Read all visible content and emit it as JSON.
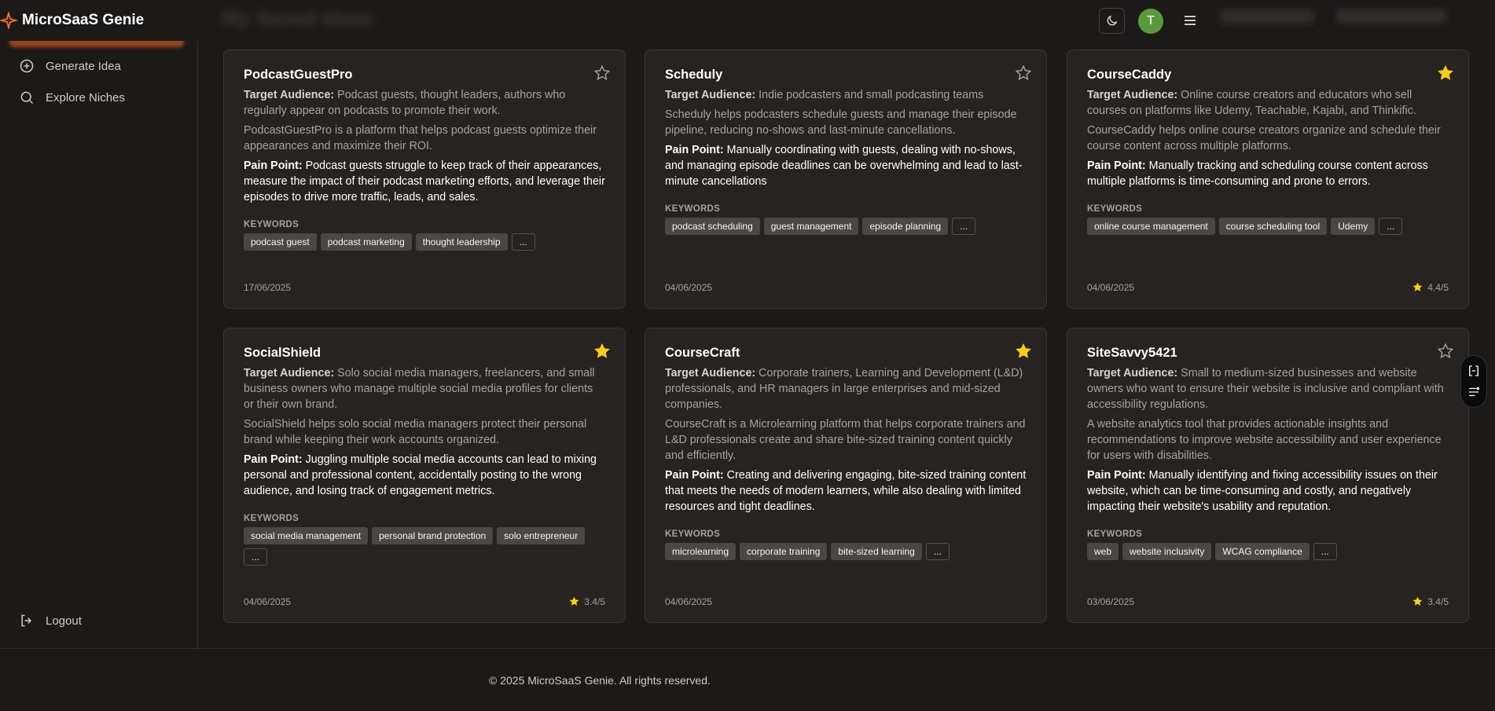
{
  "app": {
    "name": "MicroSaaS Genie",
    "avatar_initial": "T"
  },
  "sidebar": {
    "items": [
      {
        "label": "Generate Idea",
        "icon": "plus-circle-icon"
      },
      {
        "label": "Explore Niches",
        "icon": "search-icon"
      }
    ],
    "logout_label": "Logout"
  },
  "labels": {
    "target_audience": "Target Audience:",
    "pain_point": "Pain Point:",
    "keywords": "KEYWORDS",
    "more_tags": "..."
  },
  "cards": [
    {
      "title": "PodcastGuestPro",
      "favorited": false,
      "target_audience": "Podcast guests, thought leaders, authors who regularly appear on podcasts to promote their work.",
      "description": "PodcastGuestPro is a platform that helps podcast guests optimize their appearances and maximize their ROI.",
      "pain_point": "Podcast guests struggle to keep track of their appearances, measure the impact of their podcast marketing efforts, and leverage their episodes to drive more traffic, leads, and sales.",
      "keywords": [
        "podcast guest",
        "podcast marketing",
        "thought leadership"
      ],
      "date": "17/06/2025",
      "rating": ""
    },
    {
      "title": "Scheduly",
      "favorited": false,
      "target_audience": "Indie podcasters and small podcasting teams",
      "description": "Scheduly helps podcasters schedule guests and manage their episode pipeline, reducing no-shows and last-minute cancellations.",
      "pain_point": "Manually coordinating with guests, dealing with no-shows, and managing episode deadlines can be overwhelming and lead to last-minute cancellations",
      "keywords": [
        "podcast scheduling",
        "guest management",
        "episode planning"
      ],
      "date": "04/06/2025",
      "rating": ""
    },
    {
      "title": "CourseCaddy",
      "favorited": true,
      "target_audience": "Online course creators and educators who sell courses on platforms like Udemy, Teachable, Kajabi, and Thinkific.",
      "description": "CourseCaddy helps online course creators organize and schedule their course content across multiple platforms.",
      "pain_point": "Manually tracking and scheduling course content across multiple platforms is time-consuming and prone to errors.",
      "keywords": [
        "online course management",
        "course scheduling tool",
        "Udemy"
      ],
      "date": "04/06/2025",
      "rating": "4.4/5"
    },
    {
      "title": "SocialShield",
      "favorited": true,
      "target_audience": "Solo social media managers, freelancers, and small business owners who manage multiple social media profiles for clients or their own brand.",
      "description": "SocialShield helps solo social media managers protect their personal brand while keeping their work accounts organized.",
      "pain_point": "Juggling multiple social media accounts can lead to mixing personal and professional content, accidentally posting to the wrong audience, and losing track of engagement metrics.",
      "keywords": [
        "social media management",
        "personal brand protection",
        "solo entrepreneur"
      ],
      "date": "04/06/2025",
      "rating": "3.4/5"
    },
    {
      "title": "CourseCraft",
      "favorited": true,
      "target_audience": "Corporate trainers, Learning and Development (L&D) professionals, and HR managers in large enterprises and mid-sized companies.",
      "description": "CourseCraft is a Microlearning platform that helps corporate trainers and L&D professionals create and share bite-sized training content quickly and efficiently.",
      "pain_point": "Creating and delivering engaging, bite-sized training content that meets the needs of modern learners, while also dealing with limited resources and tight deadlines.",
      "keywords": [
        "microlearning",
        "corporate training",
        "bite-sized learning"
      ],
      "date": "04/06/2025",
      "rating": ""
    },
    {
      "title": "SiteSavvy5421",
      "favorited": false,
      "target_audience": "Small to medium-sized businesses and website owners who want to ensure their website is inclusive and compliant with accessibility regulations.",
      "description": "A website analytics tool that provides actionable insights and recommendations to improve website accessibility and user experience for users with disabilities.",
      "pain_point": "Manually identifying and fixing accessibility issues on their website, which can be time-consuming and costly, and negatively impacting their website's usability and reputation.",
      "keywords": [
        "web",
        "website inclusivity",
        "WCAG compliance"
      ],
      "date": "03/06/2025",
      "rating": "3.4/5"
    }
  ],
  "footer": {
    "copyright": "© 2025 MicroSaaS Genie. All rights reserved."
  },
  "colors": {
    "accent": "#f97316",
    "star": "#facc15",
    "avatar": "#5b9a3c"
  }
}
